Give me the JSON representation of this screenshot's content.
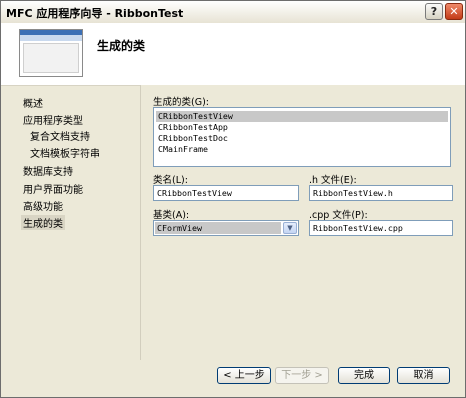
{
  "window": {
    "title": "MFC 应用程序向导 - RibbonTest",
    "help_glyph": "?",
    "close_glyph": "✕"
  },
  "banner": {
    "title": "生成的类"
  },
  "nav": {
    "items": [
      {
        "label": "概述"
      },
      {
        "label": "应用程序类型"
      },
      {
        "label": "复合文档支持"
      },
      {
        "label": "文档模板字符串"
      },
      {
        "label": "数据库支持"
      },
      {
        "label": "用户界面功能"
      },
      {
        "label": "高级功能"
      },
      {
        "label": "生成的类",
        "selected": true
      }
    ]
  },
  "generated_classes": {
    "label": "生成的类(G):",
    "items": [
      "CRibbonTestView",
      "CRibbonTestApp",
      "CRibbonTestDoc",
      "CMainFrame"
    ],
    "selected_index": 0
  },
  "class_name": {
    "label": "类名(L):",
    "value": "CRibbonTestView"
  },
  "h_file": {
    "label": ".h 文件(E):",
    "value": "RibbonTestView.h"
  },
  "base_class": {
    "label": "基类(A):",
    "value": "CFormView"
  },
  "cpp_file": {
    "label": ".cpp 文件(P):",
    "value": "RibbonTestView.cpp"
  },
  "buttons": {
    "prev": "< 上一步",
    "next": "下一步 >",
    "finish": "完成",
    "cancel": "取消"
  },
  "colors": {
    "selection": "#c8c8c8",
    "border": "#7f9db9",
    "dialog_bg": "#ece9d8"
  }
}
